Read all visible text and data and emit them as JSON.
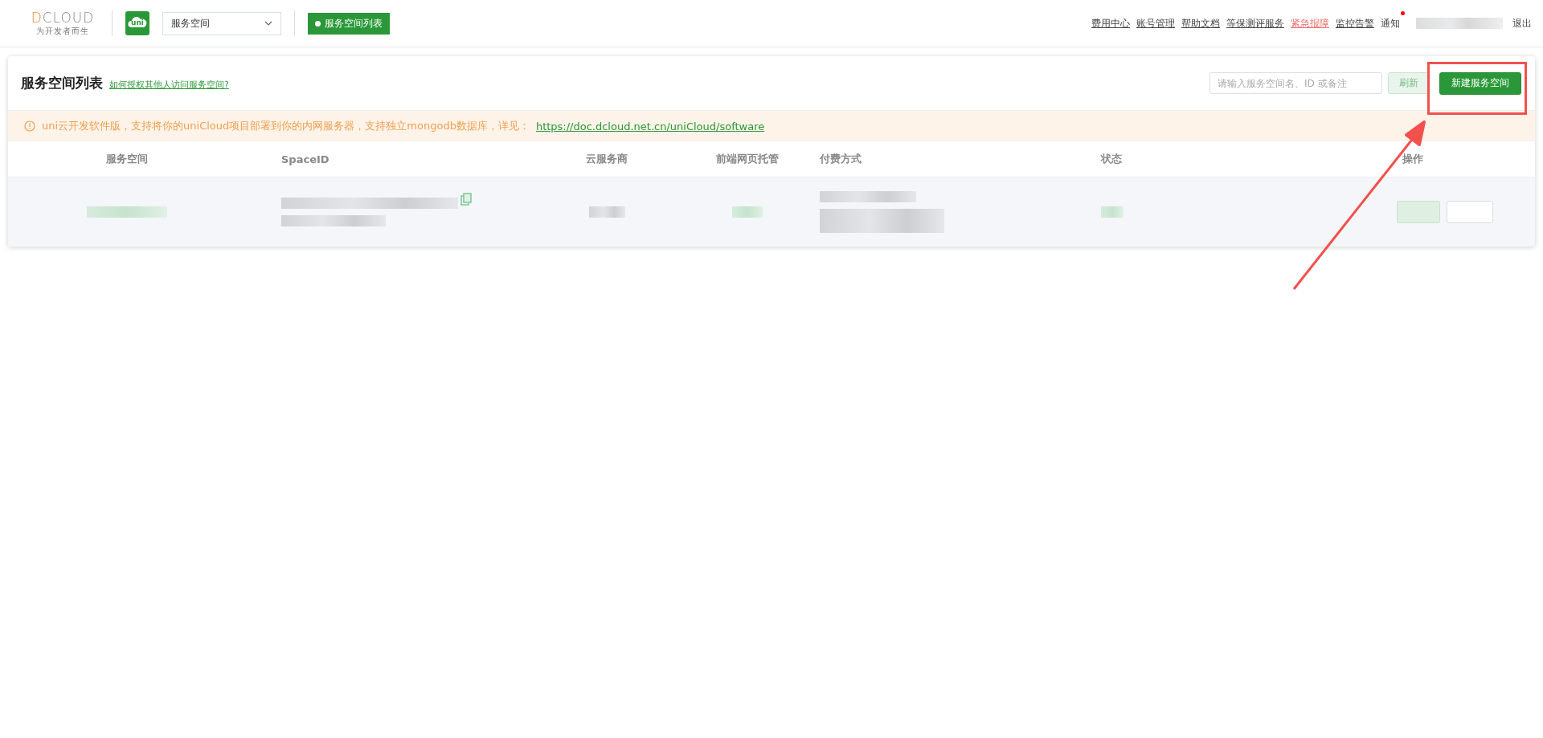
{
  "header": {
    "logo": {
      "text": "DCLOUD",
      "tagline": "为开发者而生"
    },
    "app_icon": {
      "text": "uni"
    },
    "space_select": {
      "value": "服务空间"
    },
    "current_tag": {
      "label": "服务空间列表"
    },
    "nav": [
      {
        "label": "费用中心",
        "kind": "link"
      },
      {
        "label": "账号管理",
        "kind": "link"
      },
      {
        "label": "帮助文档",
        "kind": "link"
      },
      {
        "label": "等保测评服务",
        "kind": "link"
      },
      {
        "label": "紧急报障",
        "kind": "alert"
      },
      {
        "label": "监控告警",
        "kind": "link"
      },
      {
        "label": "通知",
        "kind": "notice",
        "badge": true
      },
      {
        "kind": "user"
      },
      {
        "label": "退出",
        "kind": "plain"
      }
    ]
  },
  "panel": {
    "title": "服务空间列表",
    "help_link": "如何授权其他人访问服务空间?",
    "search": {
      "placeholder": "请输入服务空间名、ID 或备注"
    },
    "refresh_button": "刷新",
    "create_button": "新建服务空间",
    "notice": {
      "text": "uni云开发软件版，支持将你的uniCloud项目部署到你的内网服务器，支持独立mongodb数据库，详见：",
      "link": "https://doc.dcloud.net.cn/uniCloud/software"
    },
    "table": {
      "columns": [
        {
          "label": "服务空间"
        },
        {
          "label": "SpaceID"
        },
        {
          "label": "云服务商"
        },
        {
          "label": "前端网页托管"
        },
        {
          "label": "付费方式"
        },
        {
          "label": "状态"
        },
        {
          "label": "操作"
        }
      ],
      "rows": [
        {
          "kind": "redacted"
        }
      ]
    }
  },
  "annotation": {
    "kind": "highlight-arrow"
  }
}
